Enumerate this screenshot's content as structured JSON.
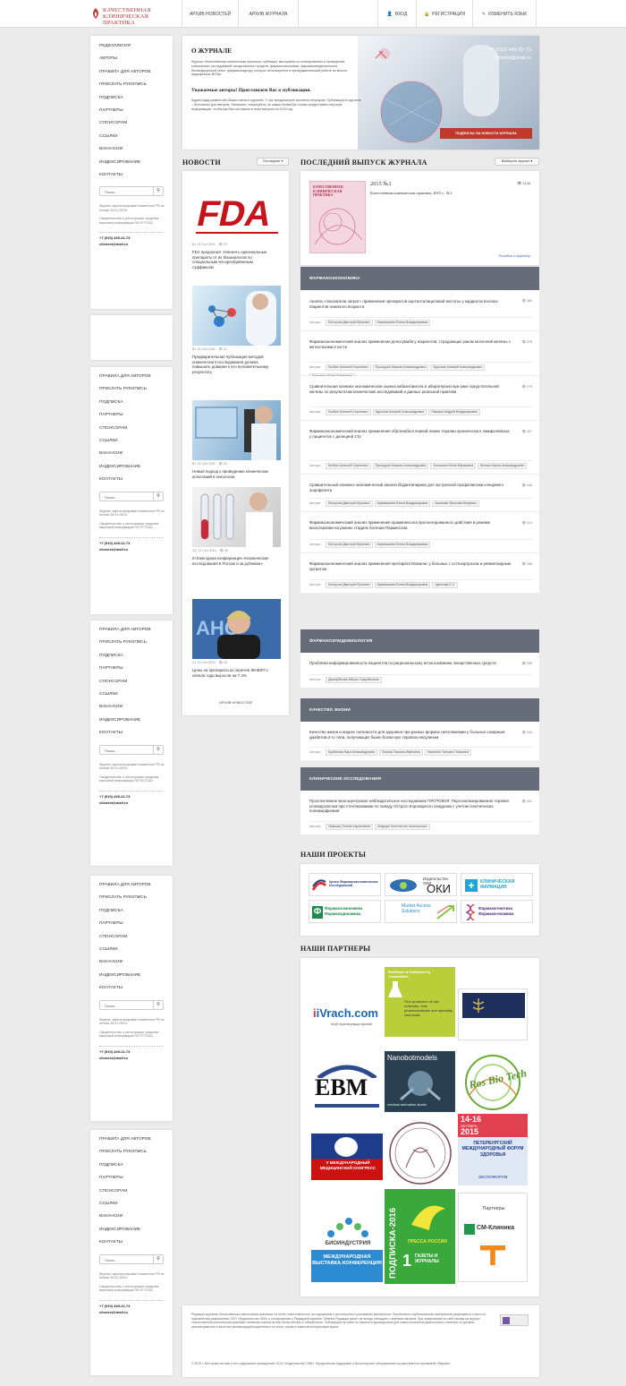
{
  "header": {
    "logo_line1": "КАЧЕСТВЕННАЯ",
    "logo_line2": "КЛИНИЧЕСКАЯ ПРАКТИКА",
    "nav_news_archive": "АРХИВ НОВОСТЕЙ",
    "nav_journal_archive": "АРХИВ ЖУРНАЛА",
    "login": "ВХОД",
    "register": "РЕГИСТРАЦИЯ",
    "language": "ИЗМЕНИТЬ ЯЗЫК"
  },
  "sidebar": {
    "items_first": [
      "РЕДКОЛЛЕГИЯ",
      "АВТОРЫ",
      "ПРАВИЛА ДЛЯ АВТОРОВ",
      "ПРИСЛАТЬ РУКОПИСЬ",
      "ПОДПИСКА",
      "ПАРТНЕРЫ",
      "СПОНСОРАМ",
      "ССЫЛКИ",
      "ВАКАНСИИ",
      "ИНДЕКСИРОВАНИЕ",
      "КОНТАКТЫ"
    ],
    "items": [
      "ПРАВИЛА ДЛЯ АВТОРОВ",
      "ПРИСЛАТЬ РУКОПИСЬ",
      "ПОДПИСКА",
      "ПАРТНЕРЫ",
      "СПОНСОРАМ",
      "ССЫЛКИ",
      "ВАКАНСИИ",
      "ИНДЕКСИРОВАНИЕ",
      "КОНТАКТЫ"
    ],
    "search_placeholder": "Поиск...",
    "note1": "Журнал зарегистрирован Комитетом РФ по печати 28.01.2001г.",
    "note2": "Свидетельство о регистрации средства массовой информации ПИ 9771342.",
    "phone": "+7 (910) 449-22-73",
    "email": "clinvest@mail.ru"
  },
  "about": {
    "title": "О ЖУРНАЛЕ",
    "phone": "+7 (910) 449-22-73",
    "email": "clinvest@mail.ru",
    "text": "Журнал «Качественная клиническая практика» публикует материалы по планированию и проведению клинических исследований лекарственных средств, фармакоэкономике, фармакоэпидемиологии, биомедицинской этике, фармаконадзору, которые используются в преподавательской работе во многих медицинских ВУЗах.",
    "subtitle": "Уважаемые авторы! Приглашаем Вас к публикации.",
    "text2": "Будем рады разместить Ваши статьи в журнале. У нас предусмотрен выплата гонораров. Публикация в журнале – бесплатны для авторов. Напишите, пожалуйста, по каким темам Вы готовы предоставить научную информацию, чтобы мы Вас поставили в план выпуска на 2015 год.",
    "subscribe": "ПОДПИСКА НА НОВОСТИ ЖУРНАЛА"
  },
  "news": {
    "title": "НОВОСТИ",
    "sort": "Последние ▾",
    "archive": "АРХИВ НОВОСТЕЙ",
    "items": [
      {
        "date": "Вт, 15 Сен 2015",
        "views": "15",
        "text": "FDA предлагает отменить оригинальные препараты от их биоаналогов по специальным четырехбуквенным суффиксам"
      },
      {
        "date": "Вт, 15 Сен 2015",
        "views": "13",
        "text": "Предварительная публикация методов клинического исследования должна повышать доверие к его положительному результату"
      },
      {
        "date": "Вт, 15 Сен 2015",
        "views": "22",
        "text": "Новый подход к проведению клинических испытаний в онкологии"
      },
      {
        "date": "Сб, 12 Сен 2015",
        "views": "30",
        "text": "III Ежегодная конференция «Клинические исследования в России и за рубежом»"
      },
      {
        "date": "Чт, 10 Сен 2015",
        "views": "24",
        "text": "Цены на препараты из перечня ЖНВЛП с начала года выросли на 7,4%"
      }
    ]
  },
  "journal": {
    "title": "ПОСЛЕДНИЙ ВЫПУСК ЖУРНАЛА",
    "select": "Выберите журнал ▾",
    "cover_title": "КАЧЕСТВЕННАЯ КЛИНИЧЕСКАЯ ПРАКТИКА",
    "issue": "2015 №1",
    "views": "1138",
    "issue_desc": "Качественная клиническая практика, 2015 г., №1",
    "link": "Перейти к журналу",
    "authors_label": "Авторы:",
    "sections": [
      {
        "name": "ФАРМАКОЭКОНОМИКА",
        "articles": [
          {
            "title": "Анализ «показатели затрат» применения препаратов ацетилсалициловой кислоты у кардиологических пациентов пожилого возраста",
            "views": "480",
            "authors": [
              "Белоусов Дмитрий Юрьевич",
              "Афанасьева Елена Владимировна"
            ]
          },
          {
            "title": "Фармакоэкономический анализ применения деносумаба у пациентов, страдающих раком молочной железы с метастазами в кости",
            "views": "376",
            "authors": [
              "Колбин Алексей Сергеевич",
              "Проскурин Максим Александрович",
              "Курылев Алексей Александрович",
              "Балыкина Юлия Ефимовна"
            ]
          },
          {
            "title": "Сравнительная клинико-экономическая оценка кабазитаксела и абиратерона при раке предстательной железы по результатам клинических исследований и данных реальной практики",
            "views": "279",
            "authors": [
              "Колбин Алексей Сергеевич",
              "Курылев Алексей Александрович",
              "Павлыш Андрей Владимирович"
            ]
          },
          {
            "title": "Фармакоэкономический анализ применения обртинаба в первой линии терапии хронического лимфолейкоза у пациентов с делецией 17р",
            "views": "407",
            "authors": [
              "Колбин Алексей Сергеевич",
              "Проскурин Максим Александрович",
              "Балыкина Юлия Ефимовна",
              "Вилюм Ирина Александровна"
            ]
          },
          {
            "title": "Сравнительный клинико-экономический анализ Йодантипирина для экстренной профилактики клещевого энцефалита",
            "views": "446",
            "authors": [
              "Белоусов Дмитрий Юрьевич",
              "Афанасьева Елена Владимировна",
              "Ашихмин Ярослав Игоревич"
            ]
          },
          {
            "title": "Фармакоэкономический анализ применения прамипексола пролонгированного действия в режиме монотерапии на ранних стадиях болезни Паркинсона",
            "views": "414",
            "authors": [
              "Белоусов Дмитрий Юрьевич",
              "Афанасьева Елена Владимировна"
            ]
          },
          {
            "title": "Фармакоэкономический анализ применения препарата Мовалис у больных с остеоартрозом и ревматоидным артритом",
            "views": "366",
            "authors": [
              "Белоусов Дмитрий Юрьевич",
              "Афанасьева Елена Владимировна",
              "Цветкова Е.С."
            ]
          }
        ]
      },
      {
        "name": "ФАРМАКОЭПИДЕМИОЛОГИЯ",
        "articles": [
          {
            "title": "Проблема информированности пациентов по рациональному использованию лекарственных средств",
            "views": "259",
            "authors": [
              "Джанубекова Айгуль Ушарбековна"
            ]
          }
        ]
      },
      {
        "name": "КАЧЕСТВО ЖИЗНИ",
        "articles": [
          {
            "title": "Качество жизни и индекс полезности для здоровья при разных формах гипогликемии у больных сахарным диабетом 2-го типа, получающих базис-болюсную терапию инсулином",
            "views": "344",
            "authors": [
              "Курбатова Кира Александровна",
              "Попова Татьяна Ивановна",
              "Никитина Татьяна Павловна"
            ]
          }
        ]
      },
      {
        "name": "КЛИНИЧЕСКИЕ ИССЛЕДОВАНИЯ",
        "articles": [
          {
            "title": "Проспективное многоцентровое наблюдательное исследование ПРОТОКОЛ: Персонализированная терапия клопидогрелом при стентировании по поводу Острого Коронарного синдрома с учетом генетических полиморфизмов",
            "views": "422",
            "authors": [
              "Лифшиц Галина Израилевна",
              "Апарцин Константин Анатольевич"
            ]
          }
        ]
      }
    ]
  },
  "projects": {
    "title": "НАШИ ПРОЕКТЫ",
    "items": [
      "Центр Фармакоэкономических Исследований",
      "",
      "Издательство ОКИ",
      "КЛИНИЧЕСКАЯ ФАРМАЦИЯ",
      "Фармакоэкономика Фармакодинамика",
      "Market Access Solutions",
      "Фармакогенетика Фармакогеномика"
    ]
  },
  "partners": {
    "title": "НАШИ ПАРТНЕРЫ",
    "ivrach": "iVrach.com",
    "ivrach_sub": "Клуб практикующих врачей",
    "chemical": "PathFinder & PathFinder by ChemicalInfo",
    "chemical_text": "Find producers of raw materials, bulk pharmaceuticals and specialty chemicals",
    "ebm": "EBM",
    "nanobot": "Nanobotmodels",
    "nanobot_sub": "medical animation studio",
    "rosbio": "Ros Bio Tech",
    "congress": "V МЕЖДУНАРОДНЫЙ МЕДИЦИНСКИЙ КОНГРЕСС",
    "forum_date": "14-16",
    "forum_month": "ОКТЯБРЬ",
    "forum_year": "2015",
    "forum_name": "ПЕТЕРБУРГСКИЙ МЕЖДУНАРОДНЫЙ ФОРУМ ЗДОРОВЬЯ",
    "forum_expo": "ЭКСПОФОРУМ",
    "bioind": "БИОИНДУСТРИЯ",
    "bioind_sub": "МЕЖДУНАРОДНАЯ ВЫСТАВКА-КОНФЕРЕНЦИЯ",
    "podpiska": "ПОДПИСКА-2016",
    "podpiska_sub": "ПРЕССА РОССИИ",
    "podpiska_n": "1",
    "podpiska_t": "ГАЗЕТЫ И ЖУРНАЛЫ",
    "partners_label": "Партнеры",
    "sm": "СМ-Клиника"
  },
  "footer": {
    "text": "Редакция журнала «Качественная клиническая практика» не несёт ответственность за содержание и достоверность рекламных материалов. Перепечатка опубликованных материалов разрешается только по письменному разрешению ООО «Издательство ОКИ» и согласованию с Редакцией журнала. Мнение Редакции может не всегда совпадать с мнением авторов. При копировании на сайт ссылка на журнал «Качественная клиническая практика» активная ссылка на http://www.clinvest.ru обязательна. Публикации на сайте не являются руководством для самостоятельной диагностики и лечения, не должны рассматриваться в качестве рекомендаций пациентам и не могут служить заменой консультации врача.",
    "copyright": "© 2015 г. Все права на сайт и его содержание принадлежат ООО «Издательство ОКИ». Юридическая поддержка и бухгалтерское обслуживание осуществляется компанией «Фармэк»."
  }
}
